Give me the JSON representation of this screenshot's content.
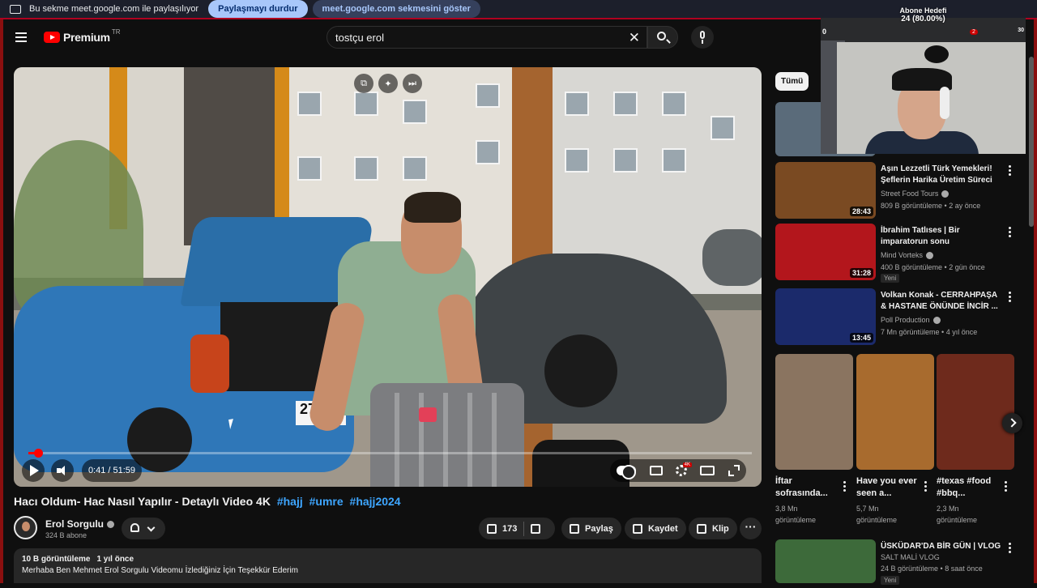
{
  "share_bar": {
    "text": "Bu sekme meet.google.com ile paylaşılıyor",
    "stop_label": "Paylaşmayı durdur",
    "show_label": "meet.google.com sekmesini göster"
  },
  "header": {
    "brand": "Premium",
    "region": "TR",
    "search_value": "tostçu erol"
  },
  "player": {
    "time": "0:41 / 51:59",
    "progress_fraction": 0.013,
    "plate_text": "27 A"
  },
  "video": {
    "title": "Hacı Oldum- Hac Nasıl Yapılır - Detaylı Video 4K",
    "hashtags": [
      "#hajj",
      "#umre",
      "#hajj2024"
    ],
    "channel": "Erol Sorgulu",
    "subscribers": "324 B abone",
    "likes": "173",
    "share_label": "Paylaş",
    "save_label": "Kaydet",
    "clip_label": "Klip",
    "views": "10 B görüntüleme",
    "age": "1 yıl önce",
    "description": "Merhaba Ben Mehmet Erol Sorgulu Videomu İzlediğiniz İçin Teşekkür Ederim"
  },
  "sidebar": {
    "chip_all": "Tümü",
    "recommendations": [
      {
        "title": "Aşın Lezzetli Türk Yemekleri! Şeflerin Harika Üretim Süreci",
        "channel": "Street Food Tours",
        "verified": true,
        "meta": "809 B görüntüleme • 2 ay önce",
        "duration": "28:43",
        "badge": "",
        "color": "#7a4a22"
      },
      {
        "title": "İbrahim Tatlıses | Bir imparatorun sonu",
        "channel": "Mind Vorteks",
        "verified": true,
        "meta": "400 B görüntüleme • 2 gün önce",
        "duration": "31:28",
        "badge": "Yeni",
        "color": "#b3161c"
      },
      {
        "title": "Volkan Konak - CERRAHPAŞA & HASTANE ÖNÜNDE İNCİR ...",
        "channel": "Poll Production",
        "verified": true,
        "meta": "7 Mn görüntüleme • 4 yıl önce",
        "duration": "13:45",
        "badge": "",
        "color": "#1b2a6b"
      },
      {
        "title": "ÜSKÜDAR'DA BİR GÜN | VLOG",
        "channel": "SALT MALİ VLOG",
        "verified": false,
        "meta": "24 B görüntüleme • 8 saat önce",
        "duration": "",
        "badge": "Yeni",
        "color": "#3d6a3a"
      }
    ],
    "shorts": [
      {
        "title": "İftar sofrasında...",
        "views": "3,8 Mn görüntüleme",
        "color": "#8a7460"
      },
      {
        "title": "Have you ever seen a...",
        "views": "5,7 Mn görüntüleme",
        "color": "#a86b2e"
      },
      {
        "title": "#texas #food #bbq...",
        "views": "2,3 Mn görüntüleme",
        "color": "#6e2a1c"
      }
    ]
  },
  "overlay": {
    "goal_title": "Abone Hedefi",
    "goal_value": "24 (80.00%)",
    "goal_min": "0",
    "goal_max": "30",
    "notification_count": "2"
  }
}
